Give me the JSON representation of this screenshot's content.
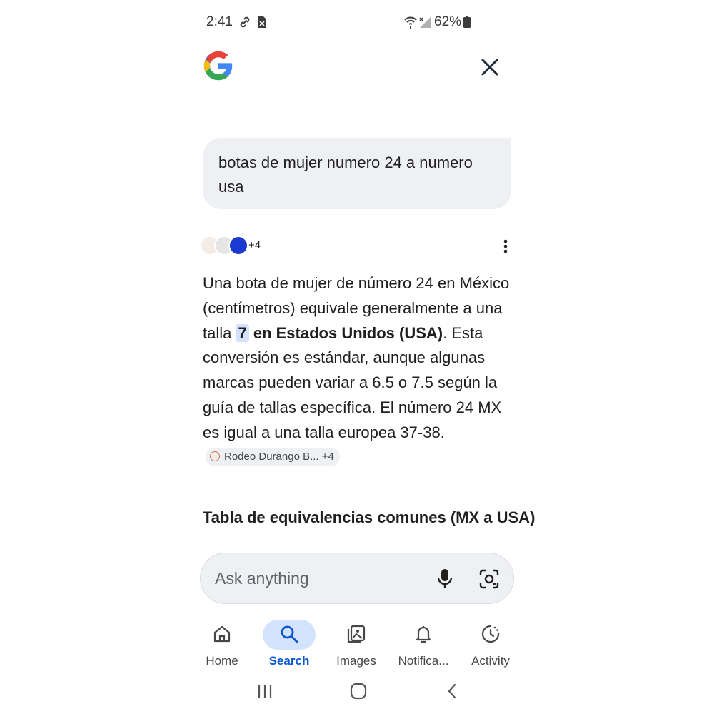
{
  "status_bar": {
    "time": "2:41",
    "battery_percent": "62%",
    "icons": [
      "link-icon",
      "close-box-icon",
      "wifi-icon",
      "signal-icon",
      "battery-icon"
    ]
  },
  "header": {
    "logo": "google-g-logo",
    "close_icon": "close-icon"
  },
  "query": {
    "text": "botas de mujer numero 24 a numero usa"
  },
  "sources": {
    "more_count": "+4"
  },
  "answer": {
    "p1": "Una bota de mujer de número 24 en México (centímetros) equivale generalmente a una talla ",
    "highlight": "7",
    "bold": " en Estados Unidos (USA)",
    "p2": ". Esta conversión es estándar, aunque algunas marcas pueden variar a 6.5 o 7.5 según la guía de tallas específica. El número 24 MX es igual a una talla europea 37-38.",
    "chip_label": "Rodeo Durango B...",
    "chip_count": "+4"
  },
  "section_heading": "Tabla de equivalencias comunes (MX a USA)",
  "ask_box": {
    "placeholder": "Ask anything"
  },
  "bottom_nav": {
    "items": [
      {
        "label": "Home",
        "icon": "home-icon"
      },
      {
        "label": "Search",
        "icon": "search-icon",
        "active": true
      },
      {
        "label": "Images",
        "icon": "images-icon"
      },
      {
        "label": "Notifica...",
        "icon": "bell-icon"
      },
      {
        "label": "Activity",
        "icon": "activity-icon"
      }
    ]
  },
  "colors": {
    "accent": "#0b57d0",
    "highlight": "#d3e3fd",
    "bubble": "#eef0f3"
  }
}
